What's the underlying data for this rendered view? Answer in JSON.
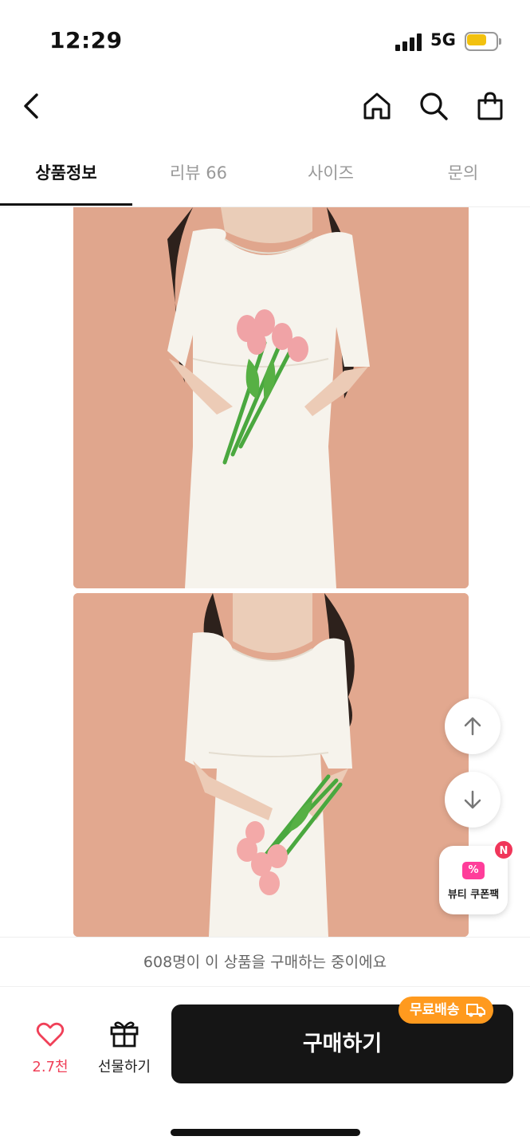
{
  "status_bar": {
    "time": "12:29",
    "network": "5G"
  },
  "tabs": [
    {
      "label": "상품정보",
      "active": true
    },
    {
      "label": "리뷰 66",
      "active": false
    },
    {
      "label": "사이즈",
      "active": false
    },
    {
      "label": "문의",
      "active": false
    }
  ],
  "floating": {
    "coupon_label": "뷰티 쿠폰팩",
    "coupon_badge": "N",
    "coupon_icon": "%"
  },
  "notice": "608명이 이 상품을 구매하는 중이에요",
  "bottom": {
    "like_count": "2.7천",
    "gift_label": "선물하기",
    "buy_label": "구매하기",
    "free_shipping_badge": "무료배송"
  },
  "icons": {
    "back": "chevron-left-icon",
    "home": "home-icon",
    "search": "search-icon",
    "cart": "shopping-bag-icon",
    "scroll_up": "arrow-up-icon",
    "scroll_down": "arrow-down-icon",
    "like": "heart-icon",
    "gift": "gift-icon",
    "truck": "truck-icon"
  },
  "colors": {
    "accent_pink": "#f04058",
    "buy_button": "#151515",
    "free_shipping": "#ff9a1e",
    "coupon": "#ff3d9a"
  }
}
